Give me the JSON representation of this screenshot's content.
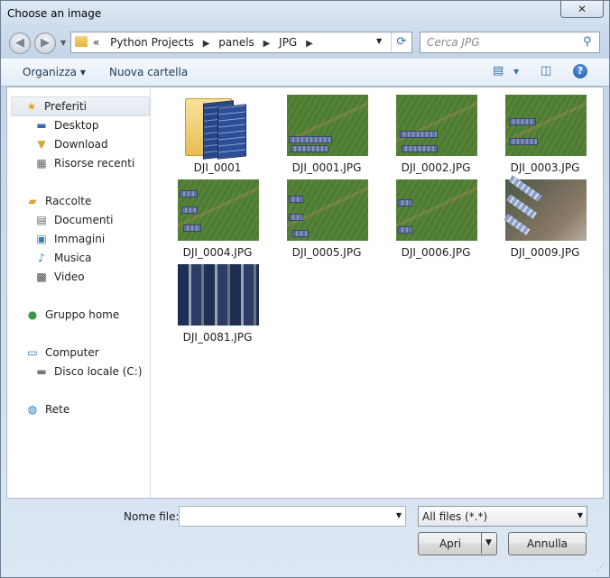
{
  "window": {
    "title": "Choose an image",
    "close_glyph": "✕"
  },
  "nav": {
    "back_icon": "back-arrow-icon",
    "forward_icon": "forward-arrow-icon",
    "breadcrumb": {
      "overflow": "«",
      "items": [
        "Python Projects",
        "panels",
        "JPG"
      ],
      "sep": "▶"
    },
    "search_placeholder": "Cerca JPG"
  },
  "toolbar": {
    "organize": "Organizza ▾",
    "new_folder": "Nuova cartella",
    "help": "?"
  },
  "sidebar": {
    "favorites": {
      "label": "Preferiti",
      "items": [
        "Desktop",
        "Download",
        "Risorse recenti"
      ]
    },
    "libraries": {
      "label": "Raccolte",
      "items": [
        "Documenti",
        "Immagini",
        "Musica",
        "Video"
      ]
    },
    "homegroup": "Gruppo home",
    "computer": {
      "label": "Computer",
      "items": [
        "Disco locale (C:)"
      ]
    },
    "network": "Rete"
  },
  "files": [
    {
      "name": "DJI_0001",
      "type": "folder"
    },
    {
      "name": "DJI_0001.JPG",
      "type": "image"
    },
    {
      "name": "DJI_0002.JPG",
      "type": "image"
    },
    {
      "name": "DJI_0003.JPG",
      "type": "image"
    },
    {
      "name": "DJI_0004.JPG",
      "type": "image"
    },
    {
      "name": "DJI_0005.JPG",
      "type": "image"
    },
    {
      "name": "DJI_0006.JPG",
      "type": "image"
    },
    {
      "name": "DJI_0009.JPG",
      "type": "image"
    },
    {
      "name": "DJI_0081.JPG",
      "type": "image"
    }
  ],
  "footer": {
    "filename_label": "Nome file:",
    "filename_value": "",
    "filter_value": "All files (*.*)",
    "open_label": "Apri",
    "cancel_label": "Annulla"
  }
}
